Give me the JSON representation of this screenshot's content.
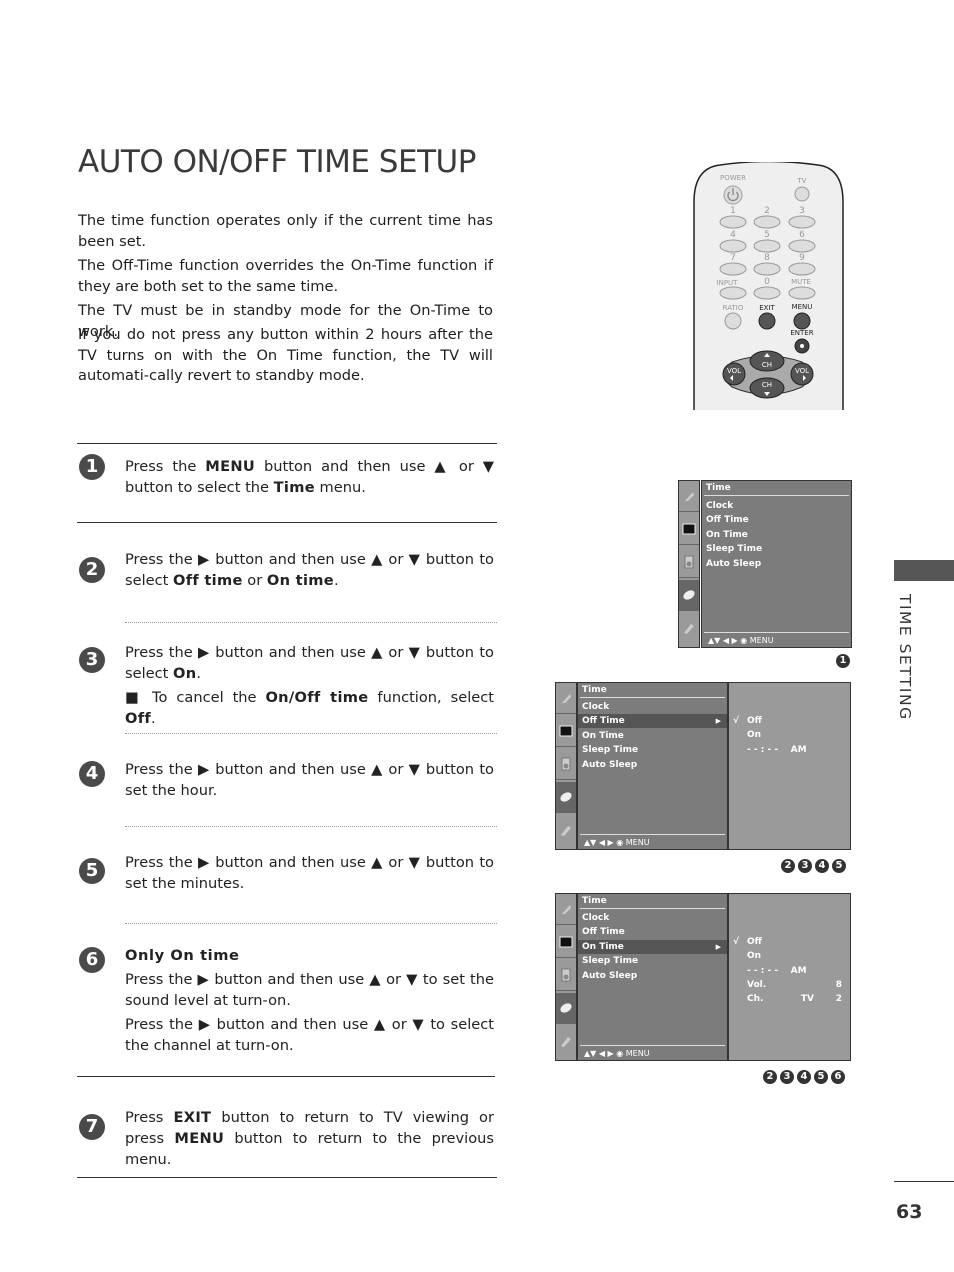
{
  "page": {
    "title": "AUTO ON/OFF TIME SETUP",
    "section_tab": "TIME SETTING",
    "page_number": "63"
  },
  "intro": [
    "The time function operates only if the current time has been set.",
    "The Off-Time function overrides the On-Time function if they are both set to the same time.",
    "The TV must be in standby mode for the On-Time to work.",
    "If you do not press any button within 2 hours after the TV turns on with the On Time function, the TV will automati-cally revert to standby mode."
  ],
  "steps": [
    {
      "num": "1",
      "parts": [
        "Press the ",
        "MENU",
        " button and then use ▲ or ▼ button to select the ",
        "Time",
        " menu."
      ]
    },
    {
      "num": "2",
      "parts": [
        "Press the ▶ button and then use ▲ or ▼ button to select ",
        "Off time",
        " or ",
        "On time",
        "."
      ]
    },
    {
      "num": "3",
      "parts": [
        "Press the ▶ button and then use ▲ or ▼ button to select ",
        "On",
        "."
      ],
      "note": [
        "■ To cancel the ",
        "On/Off time",
        " function, select ",
        "Off",
        "."
      ]
    },
    {
      "num": "4",
      "text": "Press the ▶ button and then use ▲ or ▼ button to set the hour."
    },
    {
      "num": "5",
      "text": "Press the ▶ button and then use ▲ or ▼ button to set the minutes."
    },
    {
      "num": "6",
      "heading": "Only On time",
      "p1": "Press the ▶ button and then use ▲ or ▼ to set the sound level at turn-on.",
      "p2": "Press the ▶ button and then use ▲ or ▼ to select the channel at turn-on."
    },
    {
      "num": "7",
      "parts": [
        "Press ",
        "EXIT",
        " button to return to TV viewing or press ",
        "MENU",
        " button to return to the previous menu."
      ]
    }
  ],
  "remote": {
    "labels": {
      "power": "POWER",
      "tv": "TV",
      "n1": "1",
      "n2": "2",
      "n3": "3",
      "n4": "4",
      "n5": "5",
      "n6": "6",
      "n7": "7",
      "n8": "8",
      "n9": "9",
      "input": "INPUT",
      "n0": "0",
      "mute": "MUTE",
      "ratio": "RATIO",
      "exit": "EXIT",
      "menu": "MENU",
      "enter": "ENTER",
      "ch": "CH",
      "vol": "VOL"
    }
  },
  "osd": {
    "menu_title": "Time",
    "items": [
      "Clock",
      "Off Time",
      "On Time",
      "Sleep Time",
      "Auto Sleep"
    ],
    "footer": "▲▼  ◀ ▶   ◉  MENU",
    "screens": [
      {
        "selected": null,
        "badges": [
          "1"
        ]
      },
      {
        "selected": "Off Time",
        "badges": [
          "2",
          "3",
          "4",
          "5"
        ],
        "sub": {
          "check": "√",
          "rows": [
            "Off",
            "On",
            "- - : - -    AM"
          ]
        }
      },
      {
        "selected": "On Time",
        "badges": [
          "2",
          "3",
          "4",
          "5",
          "6"
        ],
        "sub": {
          "check": "√",
          "rows": [
            "Off",
            "On",
            "- - : - -    AM"
          ],
          "vol_label": "Vol.",
          "vol_value": "8",
          "ch_label": "Ch.",
          "ch_source": "TV",
          "ch_value": "2"
        }
      }
    ]
  }
}
